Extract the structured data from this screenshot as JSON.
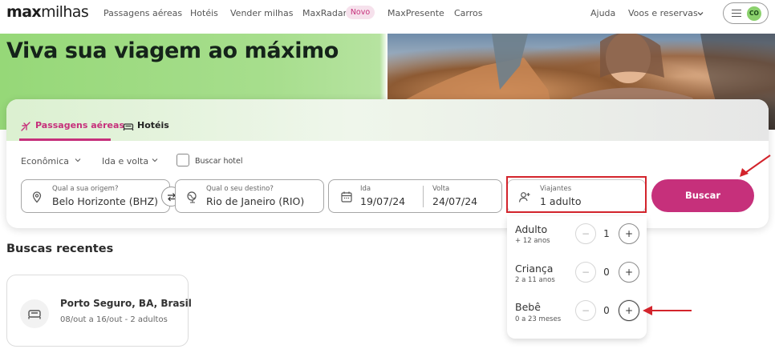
{
  "header": {
    "logo_bold": "max",
    "logo_rest": "milhas",
    "nav": {
      "passagens": "Passagens aéreas",
      "hoteis": "Hotéis",
      "vender": "Vender milhas",
      "maxradar": "MaxRadar",
      "maxradar_badge": "Novo",
      "maxpresente": "MaxPresente",
      "carros": "Carros",
      "ajuda": "Ajuda",
      "voos_reservas": "Voos e reservas"
    },
    "avatar_initials": "CO"
  },
  "hero": {
    "title": "Viva sua viagem ao máximo"
  },
  "search": {
    "tabs": {
      "flights": "Passagens aéreas",
      "hotels": "Hotéis"
    },
    "cabin_class": "Econômica",
    "trip_type": "Ida e volta",
    "hotel_checkbox_label": "Buscar hotel",
    "origin": {
      "label": "Qual a sua origem?",
      "value": "Belo Horizonte (BHZ)"
    },
    "destination": {
      "label": "Qual o seu destino?",
      "value": "Rio de Janeiro (RIO)"
    },
    "dates": {
      "depart_label": "Ida",
      "depart_value": "19/07/24",
      "return_label": "Volta",
      "return_value": "24/07/24"
    },
    "travellers": {
      "label": "Viajantes",
      "value": "1 adulto"
    },
    "search_button": "Buscar"
  },
  "travellers_dropdown": {
    "rows": [
      {
        "name": "Adulto",
        "age": "+ 12 anos",
        "count": "1"
      },
      {
        "name": "Criança",
        "age": "2 a 11 anos",
        "count": "0"
      },
      {
        "name": "Bebê",
        "age": "0 a 23 meses",
        "count": "0"
      }
    ],
    "minus_symbol": "−",
    "plus_symbol": "+"
  },
  "recent": {
    "title": "Buscas recentes",
    "items": [
      {
        "place": "Porto Seguro, BA, Brasil",
        "dates": "08/out a 16/out - 2 adultos"
      }
    ]
  },
  "colors": {
    "brand": "#c6307b",
    "hero_green": "#a7de8d",
    "highlight_red": "#d3242c"
  }
}
